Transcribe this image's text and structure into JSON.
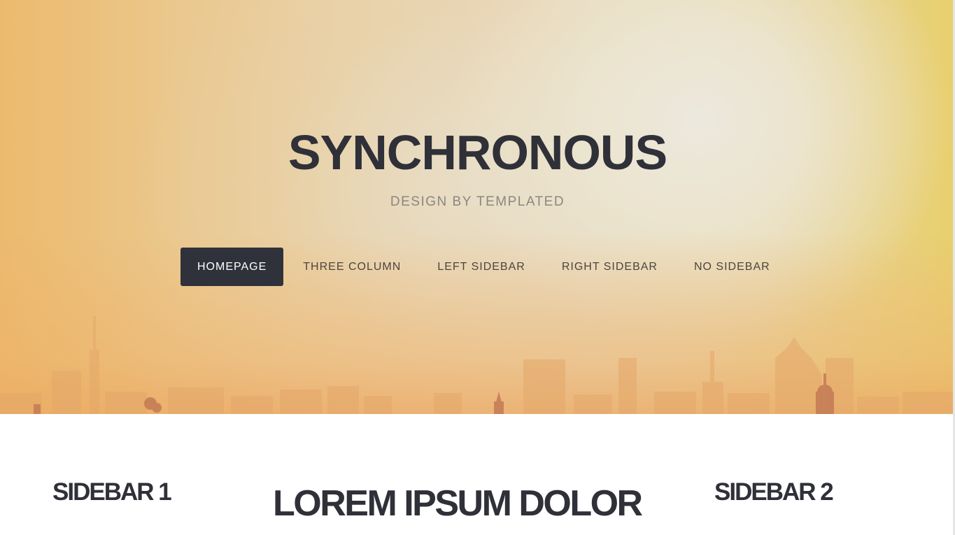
{
  "header": {
    "title": "SYNCHRONOUS",
    "subtitle": "DESIGN BY TEMPLATED"
  },
  "nav": {
    "items": [
      {
        "label": "HOMEPAGE",
        "active": true
      },
      {
        "label": "THREE COLUMN",
        "active": false
      },
      {
        "label": "LEFT SIDEBAR",
        "active": false
      },
      {
        "label": "RIGHT SIDEBAR",
        "active": false
      },
      {
        "label": "NO SIDEBAR",
        "active": false
      }
    ]
  },
  "content": {
    "sidebar1_title": "SIDEBAR 1",
    "main_title": "LOREM IPSUM DOLOR",
    "sidebar2_title": "SIDEBAR 2"
  },
  "colors": {
    "text_dark": "#2f3038",
    "nav_active_bg": "#2f323a",
    "subtitle": "#8c8680",
    "hero_warm": "#ecc37a"
  }
}
